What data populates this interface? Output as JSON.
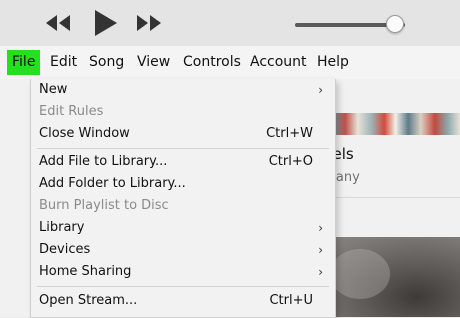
{
  "transport": {
    "previous_icon": "rewind-icon",
    "play_icon": "play-icon",
    "next_icon": "fast-forward-icon",
    "volume_level": 0.9
  },
  "menubar": {
    "items": [
      "File",
      "Edit",
      "Song",
      "View",
      "Controls",
      "Account",
      "Help"
    ],
    "active": "File",
    "active_color": "#24e01f"
  },
  "file_menu": {
    "items": [
      {
        "label": "New",
        "submenu": true,
        "submenu_icon": "chevron-right-icon"
      },
      {
        "label": "Edit Rules",
        "disabled": true
      },
      {
        "label": "Close Window",
        "shortcut": "Ctrl+W"
      },
      {
        "label": "Add File to Library...",
        "shortcut": "Ctrl+O"
      },
      {
        "label": "Add Folder to Library..."
      },
      {
        "label": "Burn Playlist to Disc",
        "disabled": true
      },
      {
        "label": "Library",
        "submenu": true,
        "submenu_icon": "chevron-right-icon"
      },
      {
        "label": "Devices",
        "submenu": true,
        "submenu_icon": "chevron-right-icon"
      },
      {
        "label": "Home Sharing",
        "submenu": true,
        "submenu_icon": "chevron-right-icon"
      },
      {
        "label": "Open Stream...",
        "shortcut": "Ctrl+U"
      }
    ],
    "submenu_arrow": "›"
  },
  "background": {
    "album_title_fragment": "allels",
    "album_artist_fragment": "mpany"
  }
}
